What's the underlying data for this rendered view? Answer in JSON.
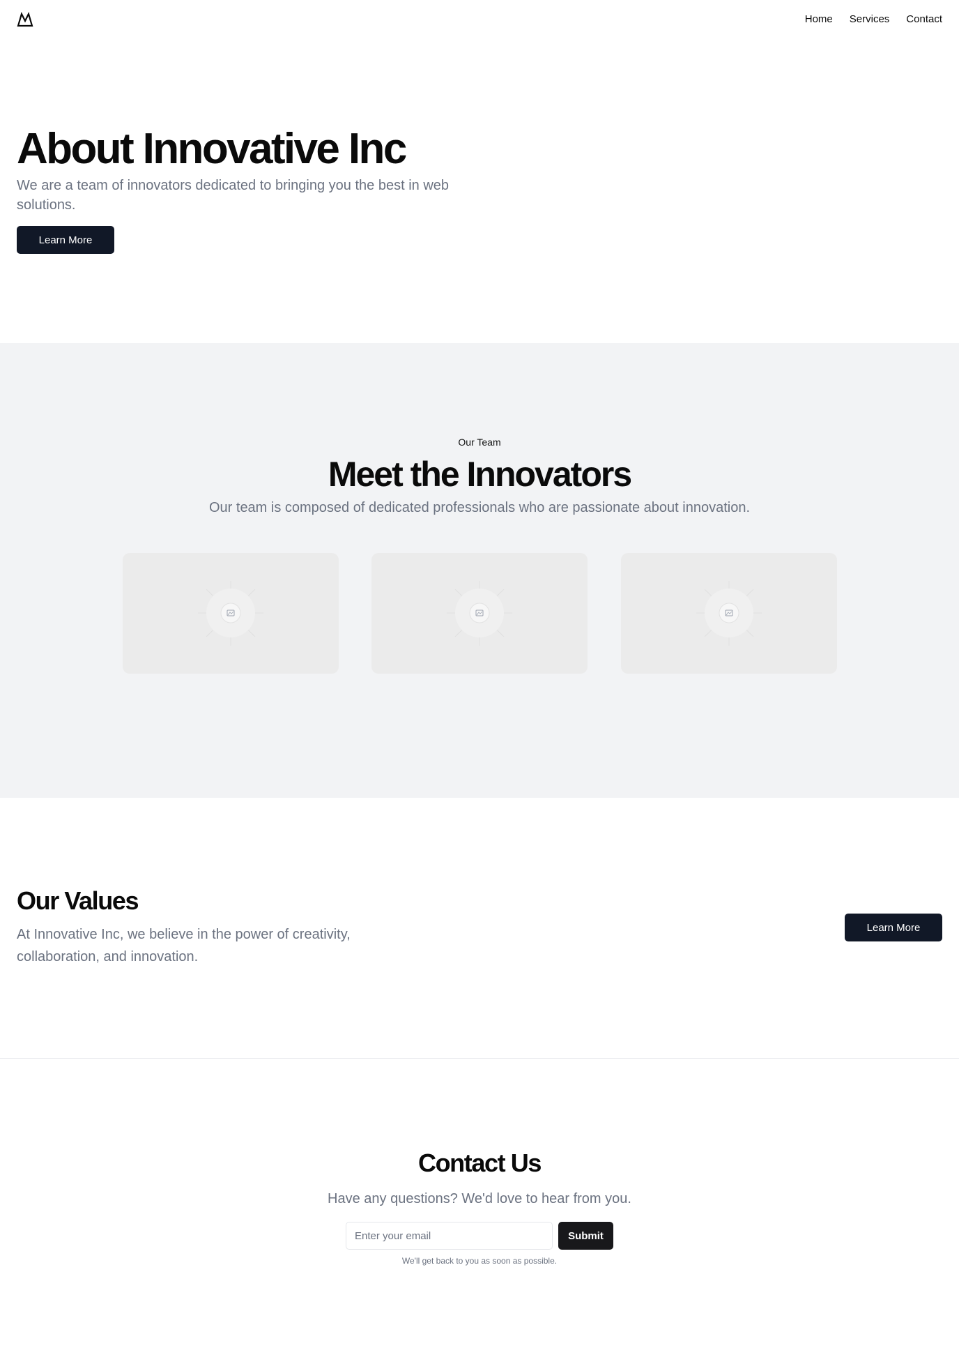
{
  "nav": {
    "logo_icon": "mountain-icon",
    "links": [
      "Home",
      "Services",
      "Contact"
    ]
  },
  "hero": {
    "title": "About Innovative Inc",
    "subtitle": "We are a team of innovators dedicated to bringing you the best in web solutions.",
    "button_label": "Learn More"
  },
  "team": {
    "eyebrow": "Our Team",
    "title": "Meet the Innovators",
    "subtitle": "Our team is composed of dedicated professionals who are passionate about innovation.",
    "cards": [
      {
        "image_icon": "image-placeholder-icon"
      },
      {
        "image_icon": "image-placeholder-icon"
      },
      {
        "image_icon": "image-placeholder-icon"
      }
    ]
  },
  "values": {
    "title": "Our Values",
    "subtitle": "At Innovative Inc, we believe in the power of creativity, collaboration, and innovation.",
    "button_label": "Learn More"
  },
  "contact": {
    "title": "Contact Us",
    "subtitle": "Have any questions? We'd love to hear from you.",
    "email_placeholder": "Enter your email",
    "email_value": "",
    "submit_label": "Submit",
    "note": "We'll get back to you as soon as possible."
  },
  "colors": {
    "primary_button": "#111827",
    "section_bg": "#f2f3f5",
    "muted_text": "#6b7280"
  }
}
